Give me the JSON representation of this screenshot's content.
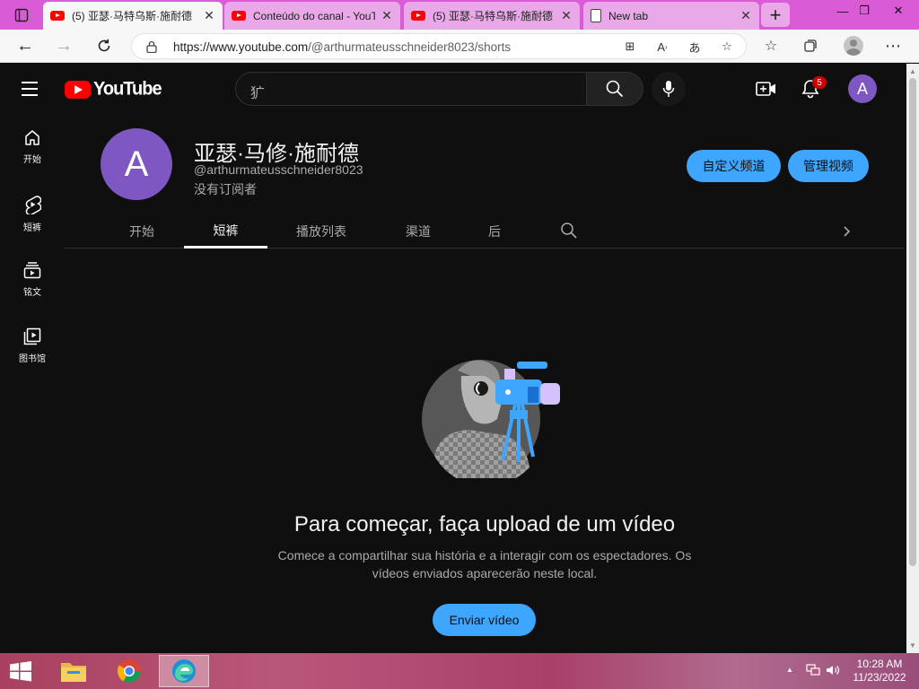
{
  "browser": {
    "tabs": [
      {
        "title": "(5) 亚瑟·马特乌斯·施耐德",
        "favicon": "youtube-icon",
        "active": true
      },
      {
        "title": "Conteúdo do canal - YouTube",
        "favicon": "youtube-icon",
        "active": false
      },
      {
        "title": "(5) 亚瑟·马特乌斯·施耐德",
        "favicon": "youtube-icon",
        "active": false
      },
      {
        "title": "New tab",
        "favicon": "page-icon",
        "active": false
      }
    ],
    "url_host": "https://www.youtube.com",
    "url_path": "/@arthurmateusschneider8023/shorts",
    "colors": {
      "tabstrip": "#d95bd6",
      "active_tab": "#f7f7f7"
    }
  },
  "youtube": {
    "logo_text": "YouTube",
    "search_value": "犷",
    "notification_count": "5",
    "account_initial": "A",
    "guide": [
      {
        "label": "开始",
        "icon": "home-icon"
      },
      {
        "label": "短裤",
        "icon": "shorts-icon"
      },
      {
        "label": "铭文",
        "icon": "subscriptions-icon"
      },
      {
        "label": "图书馆",
        "icon": "library-icon"
      }
    ],
    "channel": {
      "avatar_initial": "A",
      "name": "亚瑟·马修·施耐德",
      "handle": "@arthurmateusschneider8023",
      "subscribers": "没有订阅者",
      "customize_label": "自定义频道",
      "manage_label": "管理视频"
    },
    "tabs": [
      {
        "label": "开始",
        "selected": false
      },
      {
        "label": "短裤",
        "selected": true
      },
      {
        "label": "播放列表",
        "selected": false
      },
      {
        "label": "渠道",
        "selected": false
      },
      {
        "label": "后",
        "selected": false
      }
    ],
    "empty_state": {
      "title": "Para começar, faça upload de um vídeo",
      "description": "Comece a compartilhar sua história e a interagir com os espectadores. Os vídeos enviados aparecerão neste local.",
      "button": "Enviar vídeo"
    },
    "colors": {
      "accent": "#3ea6ff",
      "avatar": "#7e57c2",
      "background": "#0f0f0f"
    }
  },
  "taskbar": {
    "apps": [
      "file-explorer-icon",
      "chrome-icon",
      "edge-icon"
    ],
    "time": "10:28 AM",
    "date": "11/23/2022"
  }
}
